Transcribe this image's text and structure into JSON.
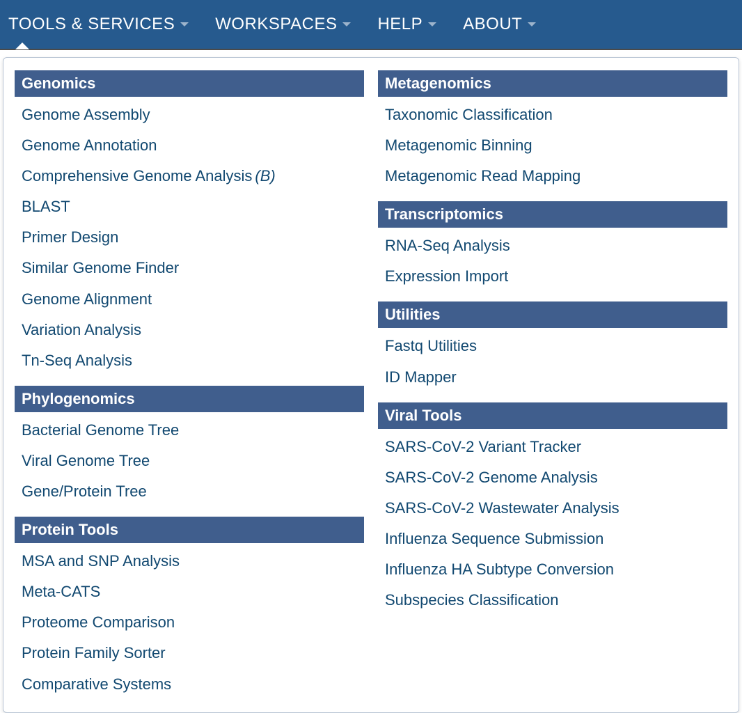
{
  "nav": {
    "items": [
      {
        "label": "TOOLS & SERVICES",
        "active": true
      },
      {
        "label": "WORKSPACES",
        "active": false
      },
      {
        "label": "HELP",
        "active": false
      },
      {
        "label": "ABOUT",
        "active": false
      }
    ]
  },
  "menu": {
    "left": [
      {
        "title": "Genomics",
        "items": [
          {
            "label": "Genome Assembly"
          },
          {
            "label": "Genome Annotation"
          },
          {
            "label": "Comprehensive Genome Analysis",
            "suffix": "(B)"
          },
          {
            "label": "BLAST"
          },
          {
            "label": "Primer Design"
          },
          {
            "label": "Similar Genome Finder"
          },
          {
            "label": "Genome Alignment"
          },
          {
            "label": "Variation Analysis"
          },
          {
            "label": "Tn-Seq Analysis"
          }
        ]
      },
      {
        "title": "Phylogenomics",
        "items": [
          {
            "label": "Bacterial Genome Tree"
          },
          {
            "label": "Viral Genome Tree"
          },
          {
            "label": "Gene/Protein Tree"
          }
        ]
      },
      {
        "title": "Protein Tools",
        "items": [
          {
            "label": "MSA and SNP Analysis"
          },
          {
            "label": "Meta-CATS"
          },
          {
            "label": "Proteome Comparison"
          },
          {
            "label": "Protein Family Sorter"
          },
          {
            "label": "Comparative Systems"
          }
        ]
      }
    ],
    "right": [
      {
        "title": "Metagenomics",
        "items": [
          {
            "label": "Taxonomic Classification"
          },
          {
            "label": "Metagenomic Binning"
          },
          {
            "label": "Metagenomic Read Mapping"
          }
        ]
      },
      {
        "title": "Transcriptomics",
        "items": [
          {
            "label": "RNA-Seq Analysis"
          },
          {
            "label": "Expression Import"
          }
        ]
      },
      {
        "title": "Utilities",
        "items": [
          {
            "label": "Fastq Utilities"
          },
          {
            "label": "ID Mapper"
          }
        ]
      },
      {
        "title": "Viral Tools",
        "items": [
          {
            "label": "SARS-CoV-2 Variant Tracker"
          },
          {
            "label": "SARS-CoV-2 Genome Analysis"
          },
          {
            "label": "SARS-CoV-2 Wastewater Analysis"
          },
          {
            "label": "Influenza Sequence Submission"
          },
          {
            "label": "Influenza HA Subtype Conversion"
          },
          {
            "label": "Subspecies Classification"
          }
        ]
      }
    ]
  }
}
